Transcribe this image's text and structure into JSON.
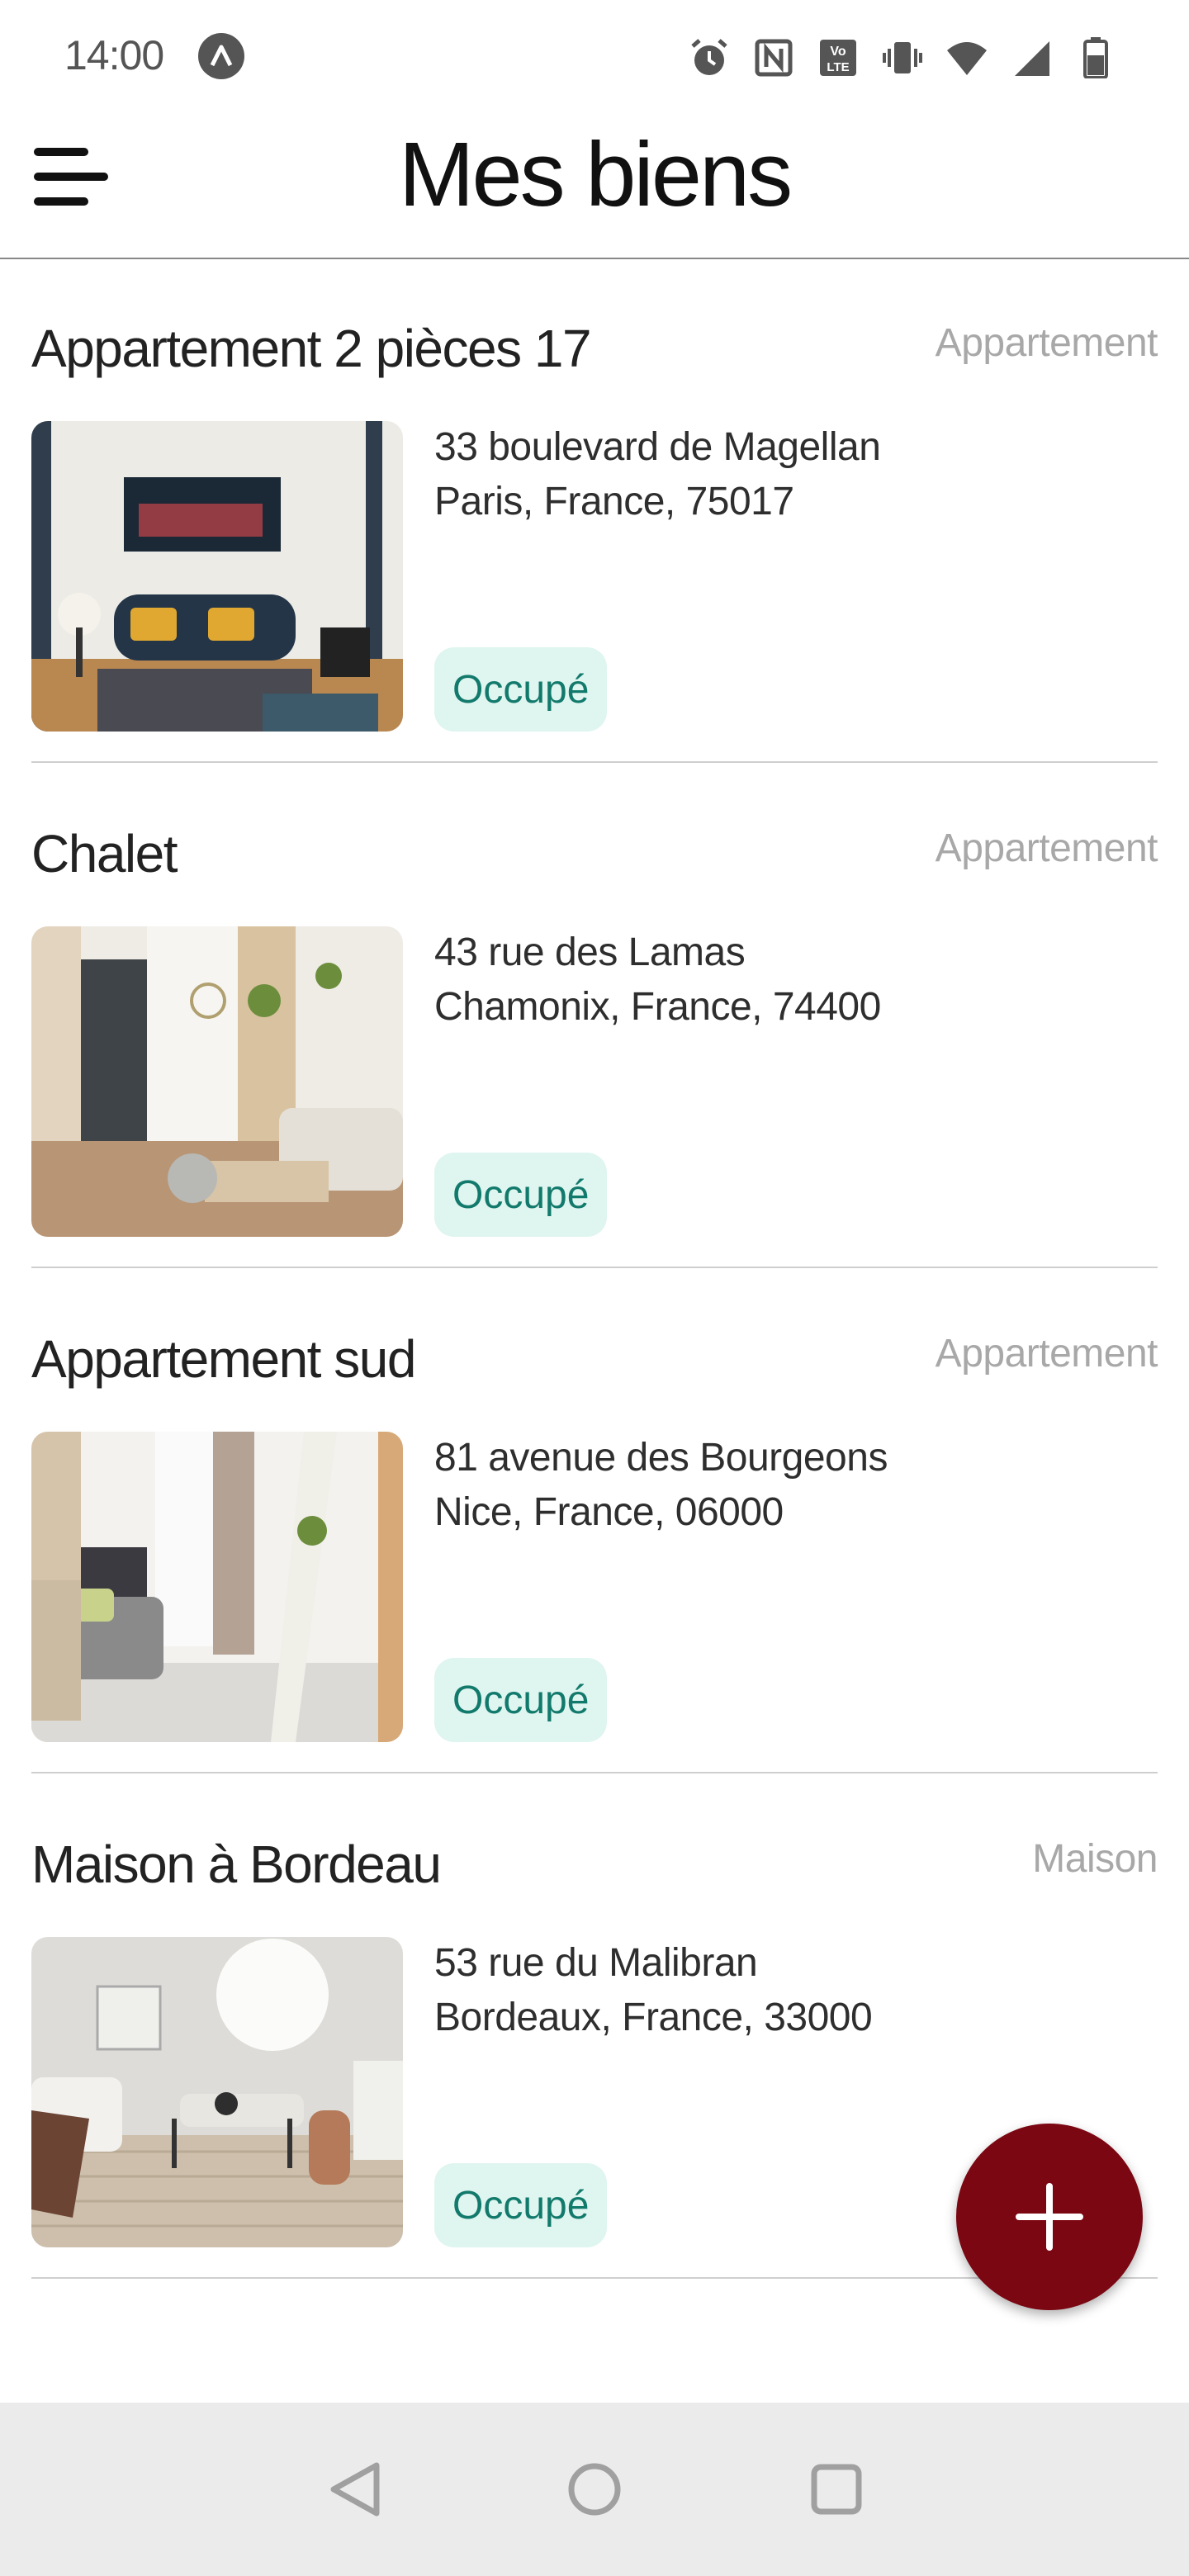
{
  "status_bar": {
    "time": "14:00",
    "icons": [
      "app-notification-icon",
      "alarm-icon",
      "nfc-icon",
      "volte-icon",
      "vibrate-icon",
      "wifi-icon",
      "signal-icon",
      "battery-icon"
    ]
  },
  "app_bar": {
    "title": "Mes biens",
    "menu_icon": "hamburger-menu-icon"
  },
  "properties": [
    {
      "name": "Appartement 2 pièces 17",
      "type": "Appartement",
      "address_line1": "33 boulevard de Magellan",
      "address_line2": "Paris, France, 75017",
      "status": "Occupé"
    },
    {
      "name": "Chalet",
      "type": "Appartement",
      "address_line1": "43 rue des Lamas",
      "address_line2": "Chamonix, France, 74400",
      "status": "Occupé"
    },
    {
      "name": "Appartement sud",
      "type": "Appartement",
      "address_line1": "81 avenue des Bourgeons",
      "address_line2": "Nice, France, 06000",
      "status": "Occupé"
    },
    {
      "name": "Maison à Bordeau",
      "type": "Maison",
      "address_line1": "53 rue du Malibran",
      "address_line2": "Bordeaux, France, 33000",
      "status": "Occupé"
    }
  ],
  "fab": {
    "icon": "plus-icon"
  },
  "nav_bar": {
    "icons": [
      "back-icon",
      "home-icon",
      "recents-icon"
    ]
  },
  "colors": {
    "accent": "#7a0712",
    "status_badge_bg": "#dff5ef",
    "status_badge_text": "#127a6c",
    "type_text": "#a8a8a8",
    "nav_bar_bg": "#ebebeb"
  }
}
